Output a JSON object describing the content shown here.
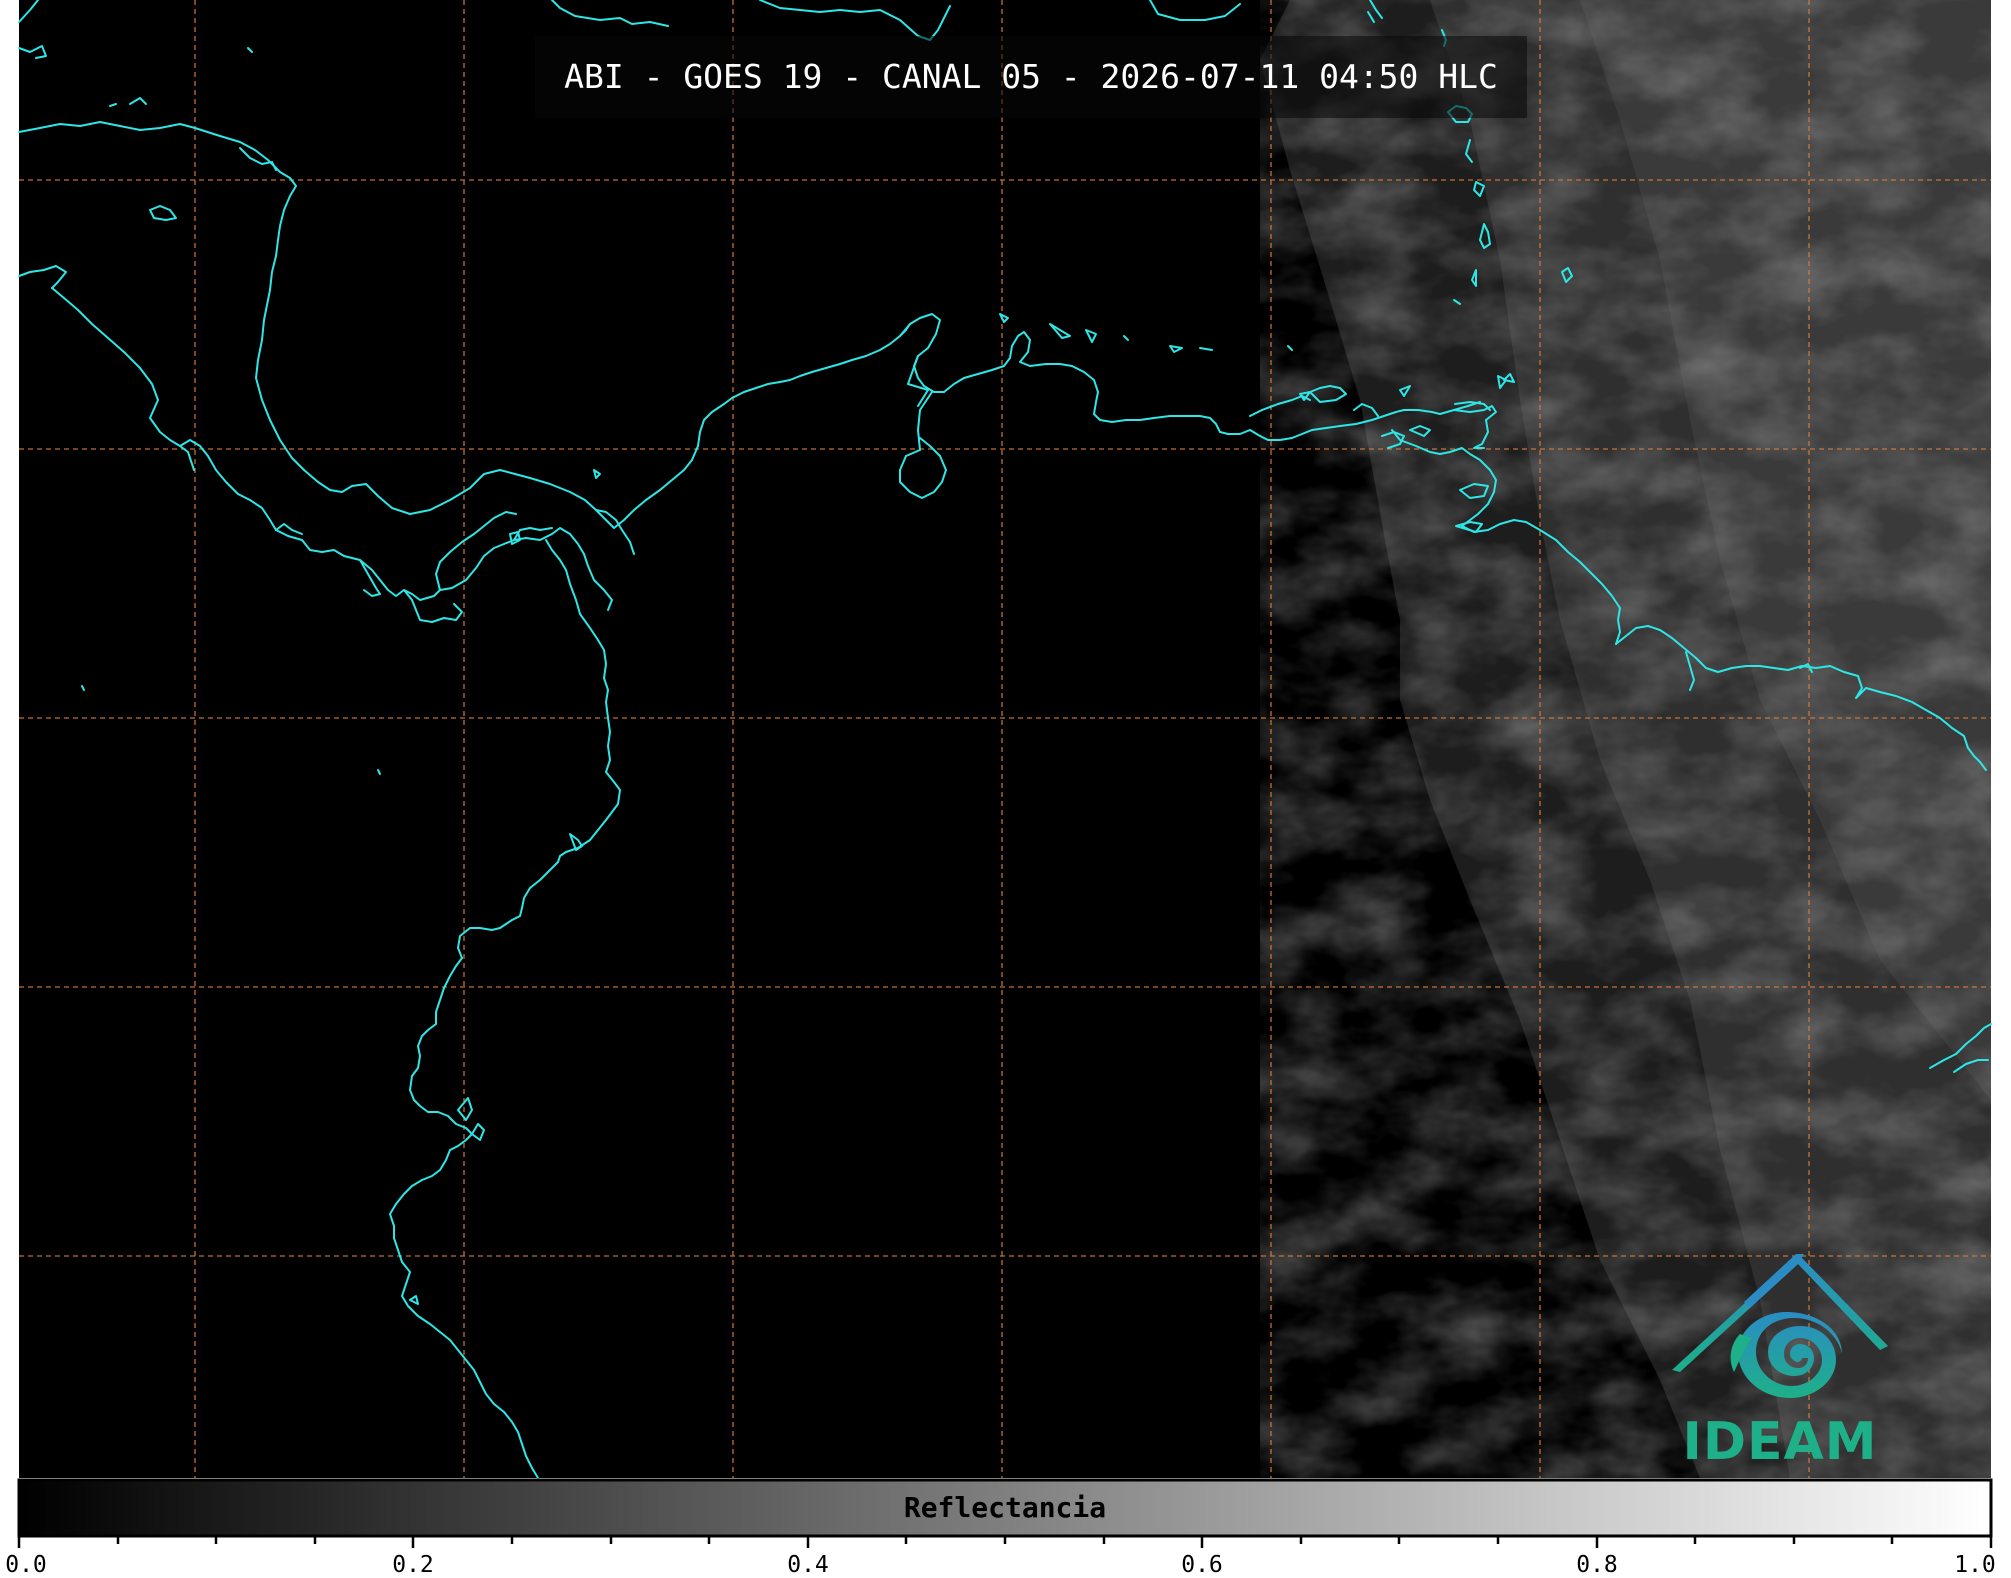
{
  "title": "ABI - GOES 19 - CANAL 05 - 2026-07-11 04:50 HLC",
  "colorbar": {
    "label": "Reflectancia",
    "range": [
      0.0,
      1.0
    ],
    "major_ticks": [
      "0.0",
      "0.2",
      "0.4",
      "0.6",
      "0.8",
      "1.0"
    ],
    "minor_tick_step": 0.05,
    "colormap": "grayscale black-to-white"
  },
  "map": {
    "background": "#000000",
    "coastline_color": "#2ee6e6",
    "graticule_color": "#d87a3a",
    "graticule_style": "dashed",
    "cloud_region": "eastern edge, grey reflectance texture"
  },
  "logo": {
    "text": "IDEAM",
    "color": "#1eb088",
    "roof_color": "#2b8cc4"
  }
}
